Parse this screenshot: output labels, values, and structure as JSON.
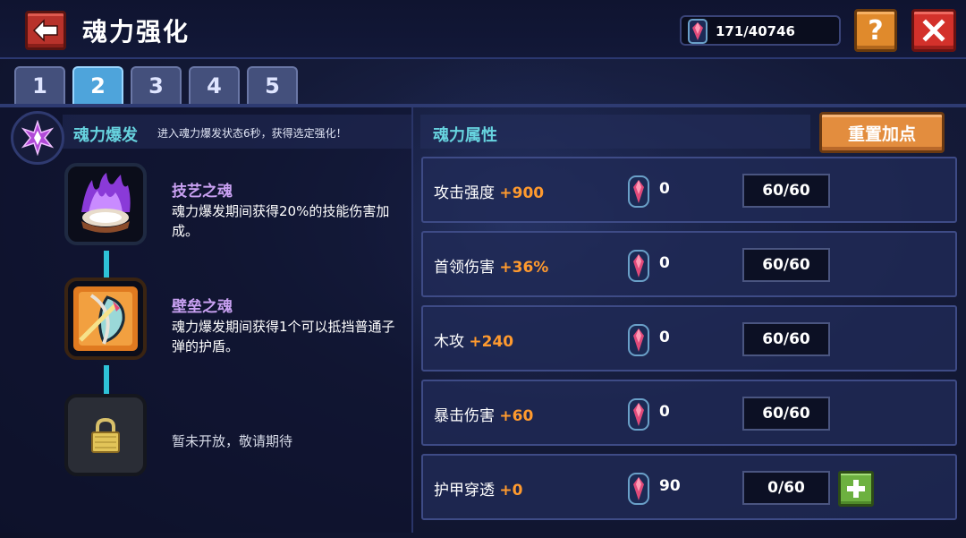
{
  "header": {
    "title": "魂力强化",
    "currency_amount": "171/40746"
  },
  "tabs": [
    {
      "label": "1",
      "active": false
    },
    {
      "label": "2",
      "active": true
    },
    {
      "label": "3",
      "active": false
    },
    {
      "label": "4",
      "active": false
    },
    {
      "label": "5",
      "active": false
    }
  ],
  "soul_burst": {
    "name": "魂力爆发",
    "description": "进入魂力爆发状态6秒，获得选定强化！",
    "skills": [
      {
        "title": "技艺之魂",
        "description": "魂力爆发期间获得20%的技能伤害加成。",
        "icon": "purple-flame-icon"
      },
      {
        "title": "壁垒之魂",
        "description": "魂力爆发期间获得1个可以抵挡普通子弹的护盾。",
        "icon": "shield-bow-icon"
      }
    ],
    "locked_text": "暂未开放，敬请期待"
  },
  "attributes": {
    "title": "魂力属性",
    "reset_label": "重置加点",
    "rows": [
      {
        "name": "攻击强度",
        "bonus": "+900",
        "cost": "0",
        "level": "60/60",
        "can_upgrade": false
      },
      {
        "name": "首领伤害",
        "bonus": "+36%",
        "cost": "0",
        "level": "60/60",
        "can_upgrade": false
      },
      {
        "name": "木攻",
        "bonus": "+240",
        "cost": "0",
        "level": "60/60",
        "can_upgrade": false
      },
      {
        "name": "暴击伤害",
        "bonus": "+60",
        "cost": "0",
        "level": "60/60",
        "can_upgrade": false
      },
      {
        "name": "护甲穿透",
        "bonus": "+0",
        "cost": "90",
        "level": "0/60",
        "can_upgrade": true
      }
    ]
  },
  "colors": {
    "accent_cyan": "#67d3df",
    "bonus_orange": "#ff9a2e",
    "skill_title_purple": "#c9a1f2"
  }
}
